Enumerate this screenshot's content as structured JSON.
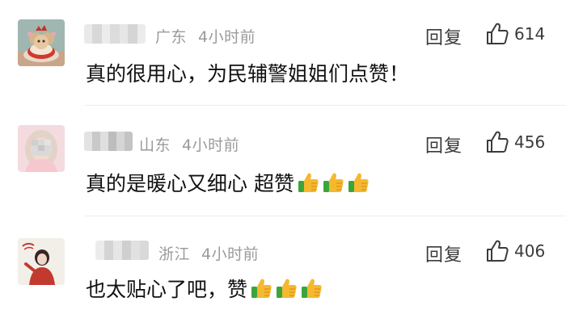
{
  "comments": [
    {
      "location": "广东",
      "time": "4小时前",
      "reply_label": "回复",
      "likes": "614",
      "text": "真的很用心，为民辅警姐姐们点赞！",
      "emojis": [],
      "avatar_icon": "cake-avatar"
    },
    {
      "location": "山东",
      "time": "4小时前",
      "reply_label": "回复",
      "likes": "456",
      "text": "真的是暖心又细心 超赞",
      "emojis": [
        "thumbs-up",
        "thumbs-up",
        "thumbs-up"
      ],
      "avatar_icon": "girl-avatar"
    },
    {
      "location": "浙江",
      "time": "4小时前",
      "reply_label": "回复",
      "likes": "406",
      "text": "也太贴心了吧，赞",
      "emojis": [
        "thumbs-up",
        "thumbs-up",
        "thumbs-up"
      ],
      "avatar_icon": "woman-avatar"
    }
  ],
  "colors": {
    "meta": "#9a9a9a",
    "text": "#111111",
    "emoji_yellow": "#f5b82e",
    "emoji_green": "#3aa53a"
  }
}
